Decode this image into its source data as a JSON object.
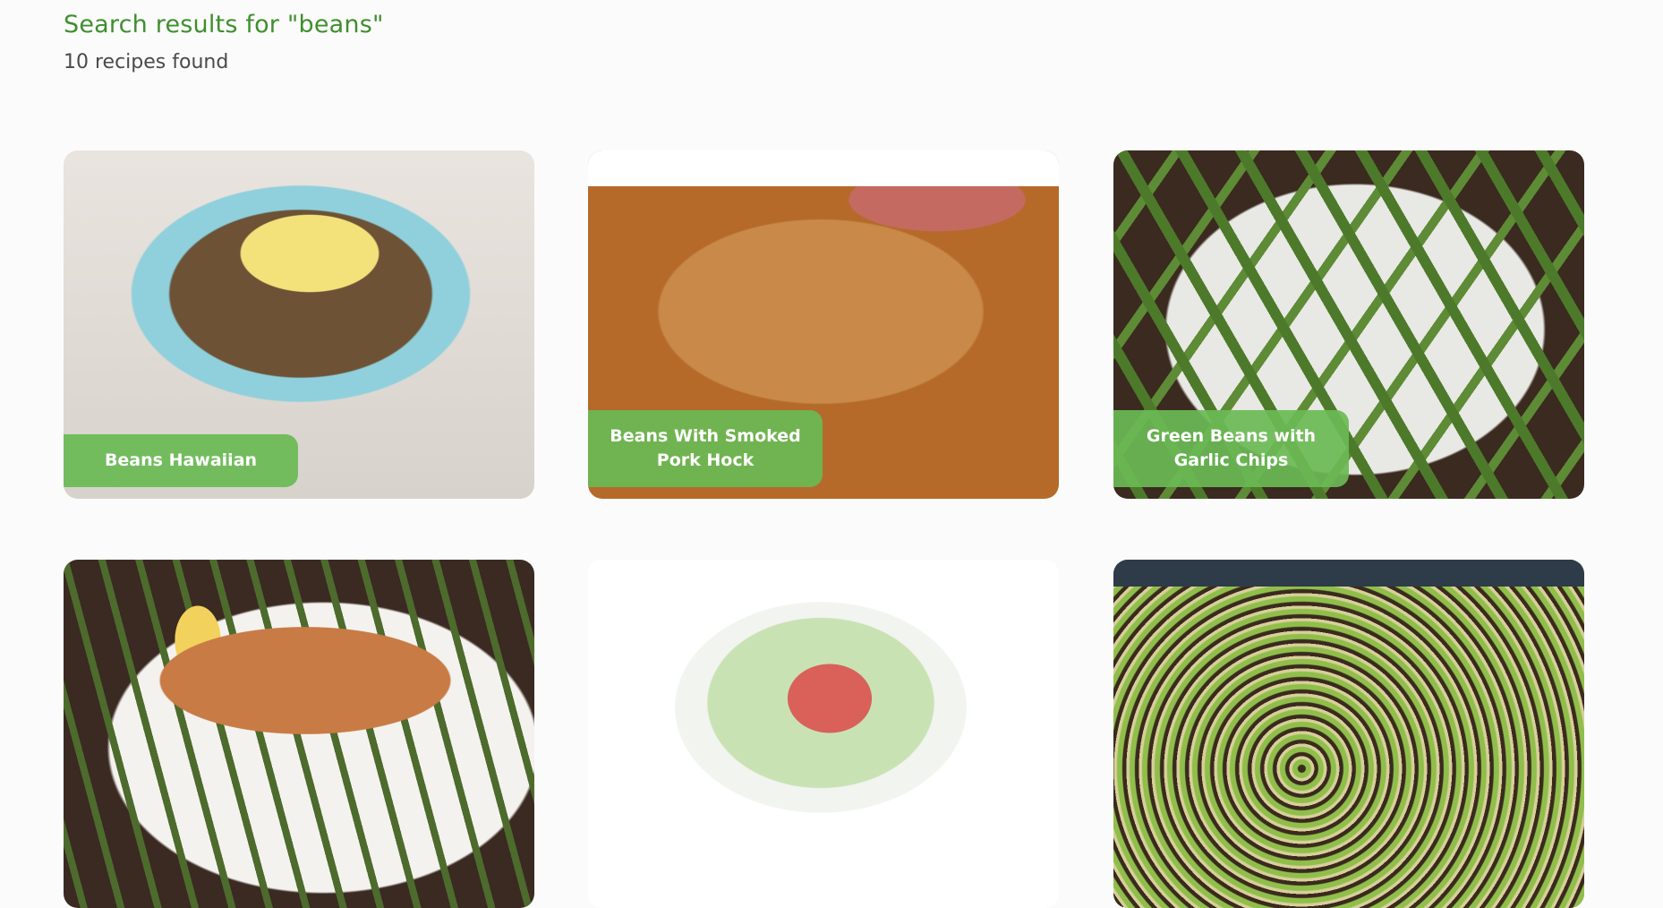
{
  "search": {
    "title": "Search results for \"beans\"",
    "count": "10 recipes found"
  },
  "recipes": [
    {
      "title": "Beans Hawaiian"
    },
    {
      "title": "Beans With Smoked Pork Hock"
    },
    {
      "title": "Green Beans with Garlic Chips"
    },
    {
      "title": ""
    },
    {
      "title": ""
    },
    {
      "title": ""
    }
  ],
  "colors": {
    "accent": "#3f8f2e",
    "label_bg": "#6aba55"
  }
}
